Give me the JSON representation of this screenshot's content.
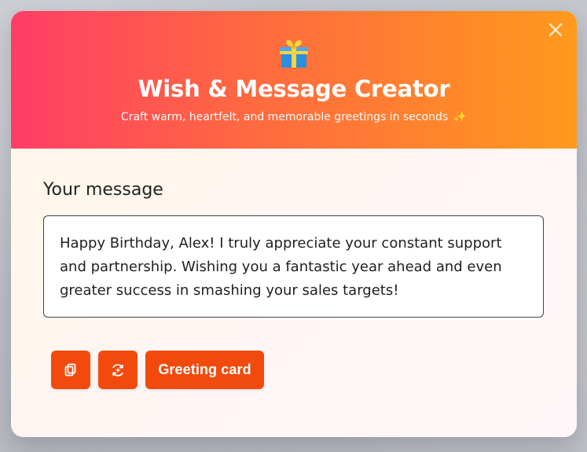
{
  "app": {
    "title": "Wish & Message Creator",
    "subtitle": "Craft warm, heartfelt, and memorable greetings in seconds",
    "sparkle": "✨",
    "gift_icon": "gift-icon",
    "close_icon": "close-icon"
  },
  "message": {
    "label": "Your message",
    "text": "Happy Birthday, Alex! I truly appreciate your constant support and partnership. Wishing you a fantastic year ahead and even greater success in smashing your sales targets!"
  },
  "actions": {
    "copy_icon": "copy-icon",
    "regenerate_icon": "regenerate-icon",
    "greeting_card_label": "Greeting card"
  },
  "colors": {
    "header_start": "#ff3d67",
    "header_end": "#ff9a1d",
    "accent": "#f24a0d",
    "text_dark": "#222222",
    "panel_background": "#fff6f4"
  }
}
